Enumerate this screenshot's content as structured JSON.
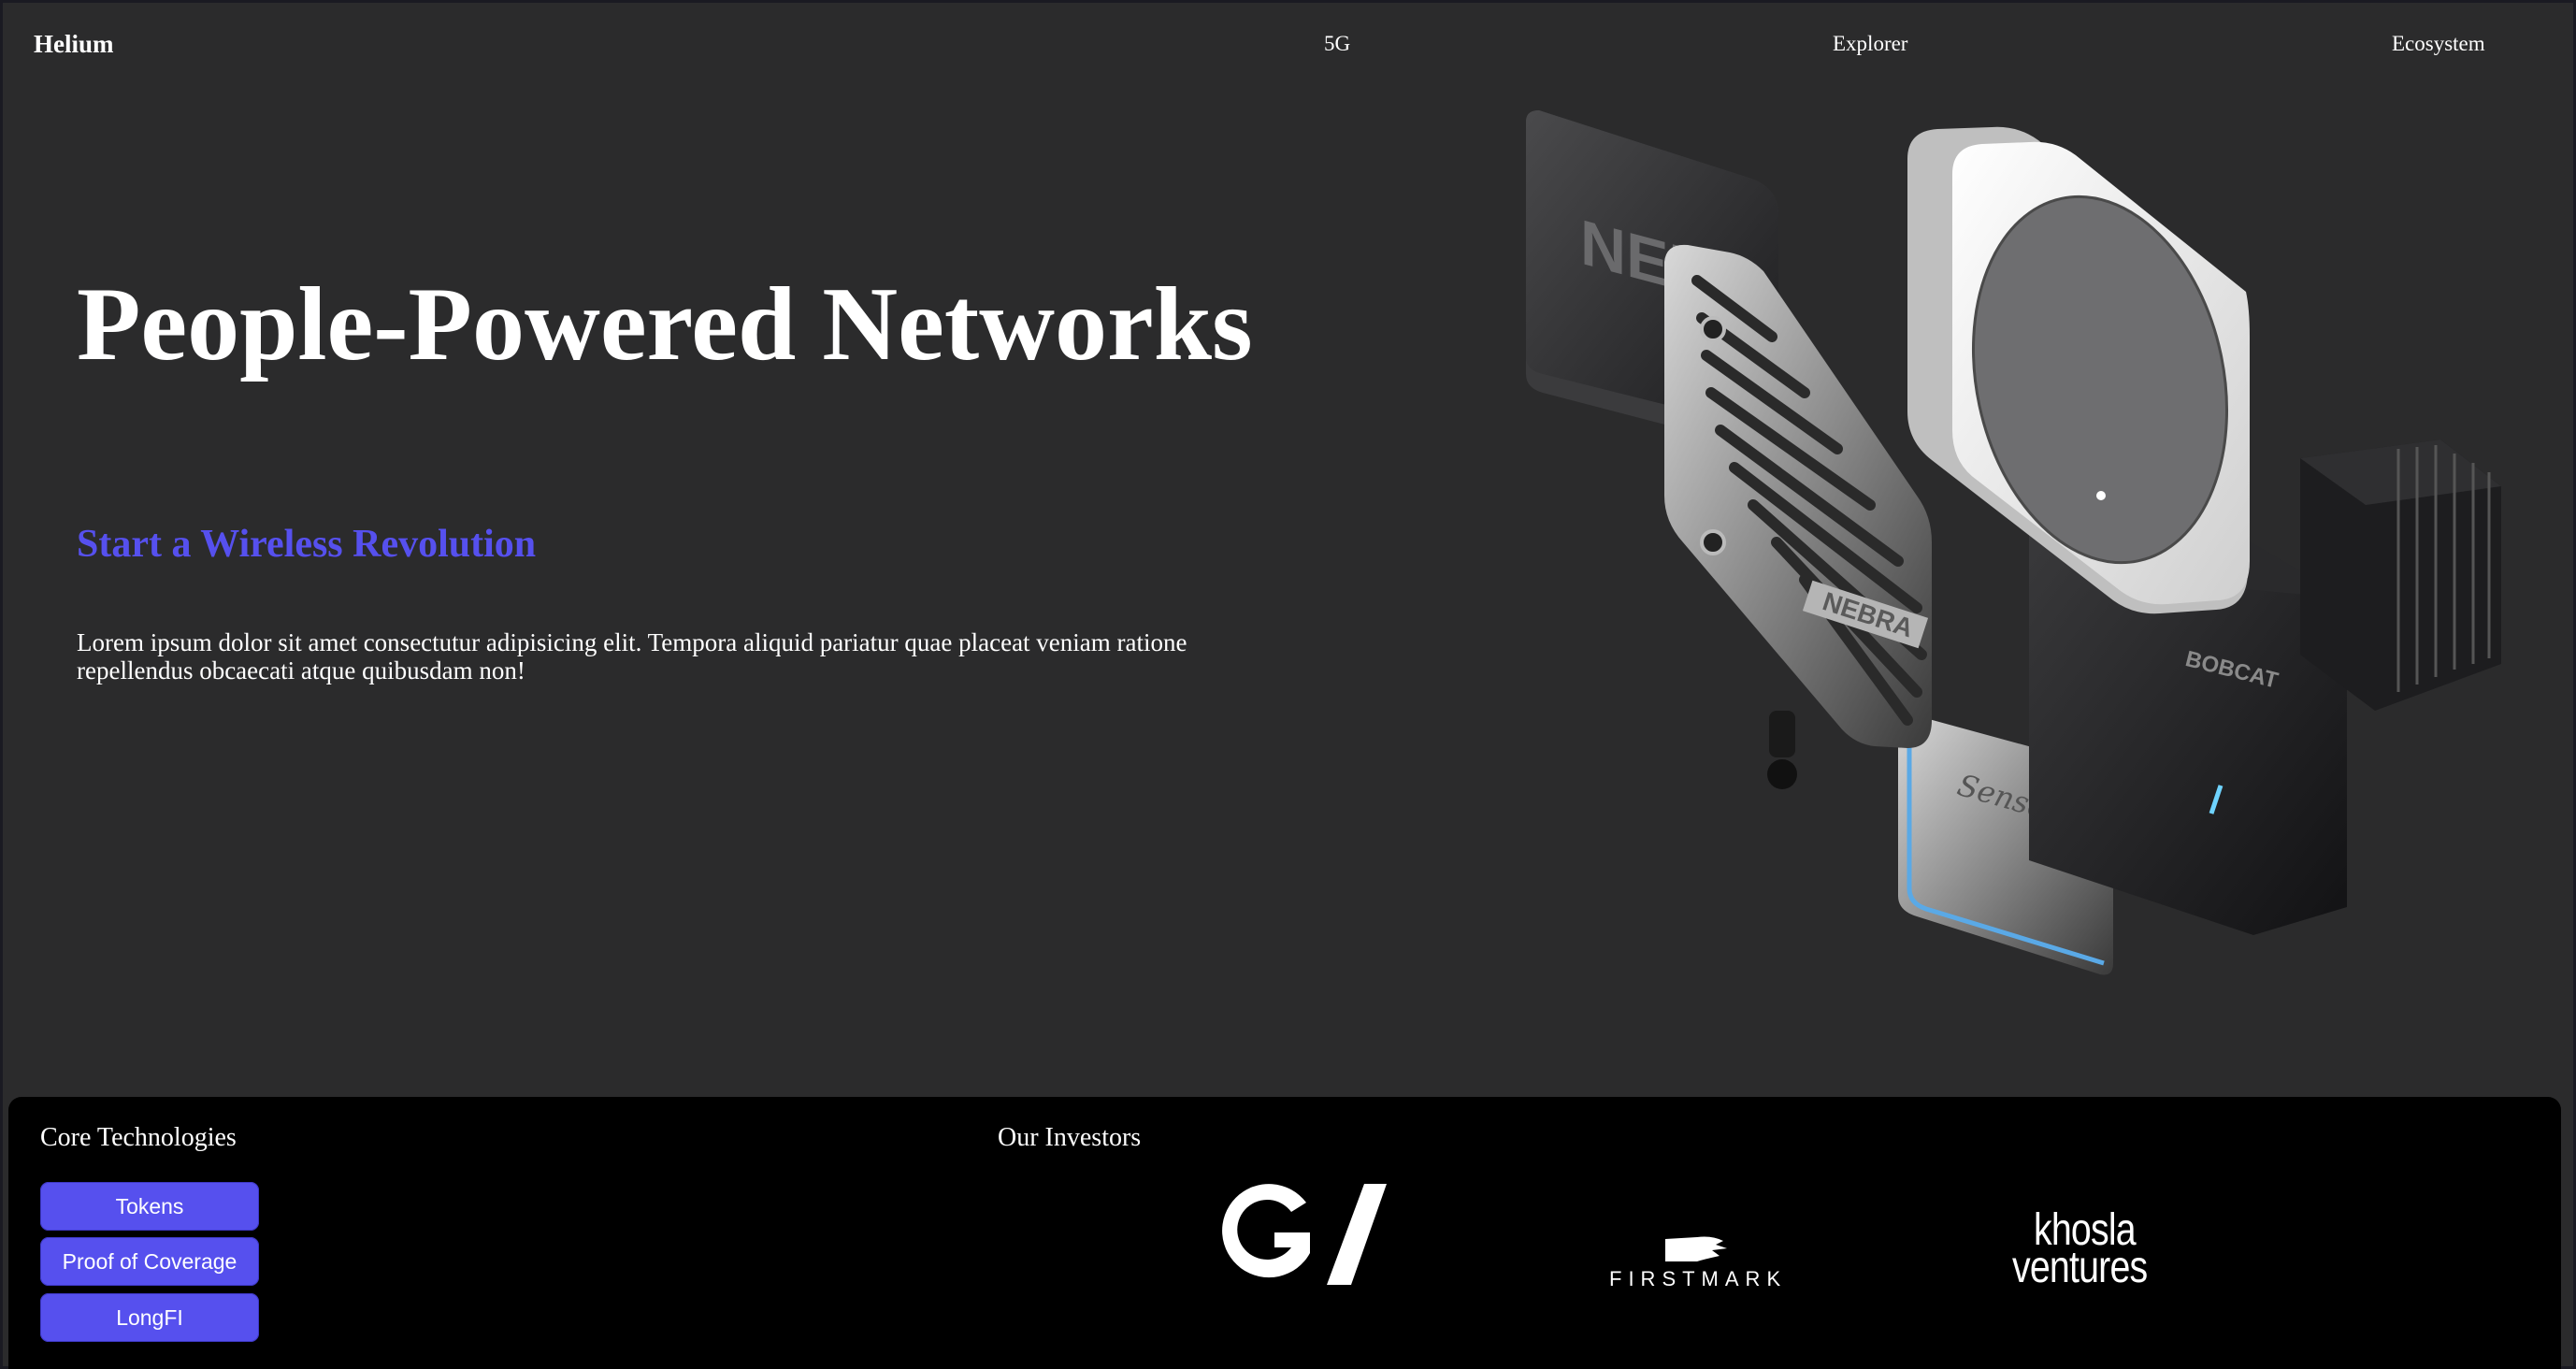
{
  "nav": {
    "brand": "Helium",
    "links": [
      "5G",
      "Explorer",
      "Ecosystem"
    ]
  },
  "hero": {
    "title": "People-Powered Networks",
    "subtitle": "Start a Wireless Revolution",
    "body": "Lorem ipsum dolor sit amet consectutur adipisicing elit. Tempora aliquid pariatur quae placeat veniam ratione repellendus obcaecati atque quibusdam non!",
    "device_labels": {
      "nebra_back": "NEB",
      "nebra_front": "NEBRA",
      "bobcat": "BOBCAT",
      "sensecap": "SenseCap"
    }
  },
  "footer": {
    "core_title": "Core Technologies",
    "buttons": [
      "Tokens",
      "Proof of Coverage",
      "LongFI"
    ],
    "investors_title": "Our Investors",
    "investors": {
      "gv": "GV",
      "firstmark": "FIRSTMARK",
      "khosla_line1": "khosla",
      "khosla_line2": "ventures"
    }
  },
  "colors": {
    "background": "#2b2b2c",
    "accent": "#5650ee",
    "footer_bg": "#000000",
    "text": "#ffffff"
  }
}
